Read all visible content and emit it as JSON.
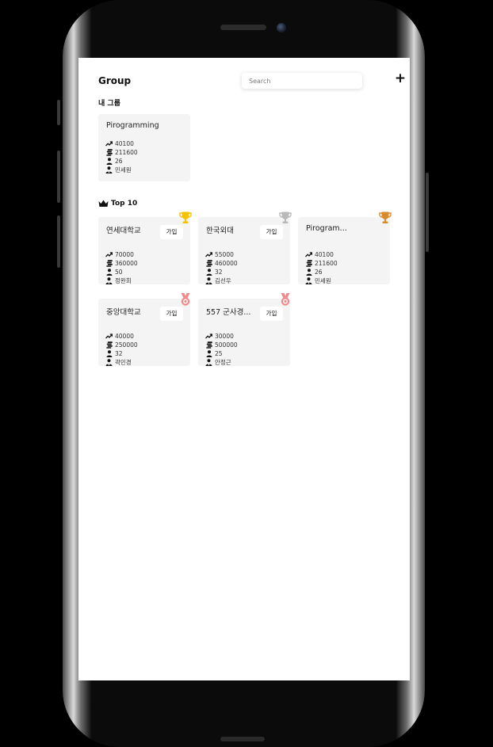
{
  "app": {
    "title": "Group"
  },
  "search": {
    "placeholder": "Search"
  },
  "header": {
    "add_label": "+"
  },
  "sections": {
    "my_groups": "내 그룹",
    "top10": "Top 10"
  },
  "my_groups": [
    {
      "name": "Pirogramming",
      "growth": "40100",
      "total": "211600",
      "members": "26",
      "leader": "민세원"
    }
  ],
  "top10": [
    {
      "name": "연세대학교",
      "join": "가입",
      "growth": "70000",
      "total": "360000",
      "members": "50",
      "leader": "정완희",
      "badge": "gold-trophy"
    },
    {
      "name": "한국외대",
      "join": "가입",
      "growth": "55000",
      "total": "460000",
      "members": "32",
      "leader": "김선우",
      "badge": "silver-trophy"
    },
    {
      "name": "Pirogram...",
      "growth": "40100",
      "total": "211600",
      "members": "26",
      "leader": "민세원",
      "badge": "bronze-trophy"
    },
    {
      "name": "중앙대학교",
      "join": "가입",
      "growth": "40000",
      "total": "250000",
      "members": "32",
      "leader": "곽민경",
      "badge": "medal"
    },
    {
      "name": "557 군사경...",
      "join": "가입",
      "growth": "30000",
      "total": "500000",
      "members": "25",
      "leader": "안정근",
      "badge": "medal"
    }
  ],
  "colors": {
    "gold": "#F5C400",
    "silver": "#B9B9B9",
    "bronze": "#D98A2B",
    "medal": "#F08A8A",
    "card_bg": "#F4F4F4"
  }
}
